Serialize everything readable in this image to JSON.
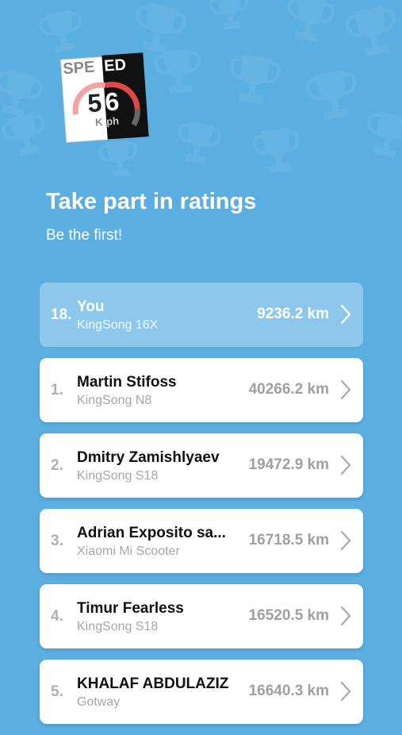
{
  "header": {
    "logo": {
      "label_left": "SPE",
      "label_right": "ED",
      "digit_left": "5",
      "digit_right": "6",
      "unit_left": "K",
      "unit_right": "ph"
    },
    "title": "Take part in ratings",
    "subtitle": "Be the first!"
  },
  "colors": {
    "background": "#5AAEE0",
    "current_user_row": "#8DC8EC",
    "row": "#FFFFFF"
  },
  "ratings": [
    {
      "rank": "18.",
      "name": "You",
      "device": "KingSong 16X",
      "distance": "9236.2 km",
      "current_user": true
    },
    {
      "rank": "1.",
      "name": "Martin Stifoss",
      "device": "KingSong N8",
      "distance": "40266.2 km",
      "current_user": false
    },
    {
      "rank": "2.",
      "name": "Dmitry Zamishlyaev",
      "device": "KingSong S18",
      "distance": "19472.9 km",
      "current_user": false
    },
    {
      "rank": "3.",
      "name": "Adrian Exposito sa...",
      "device": "Xiaomi Mi Scooter",
      "distance": "16718.5 km",
      "current_user": false
    },
    {
      "rank": "4.",
      "name": "Timur Fearless",
      "device": "KingSong S18",
      "distance": "16520.5 km",
      "current_user": false
    },
    {
      "rank": "5.",
      "name": "KHALAF ABDULAZIZ",
      "device": "Gotway",
      "distance": "16640.3 km",
      "current_user": false
    }
  ]
}
